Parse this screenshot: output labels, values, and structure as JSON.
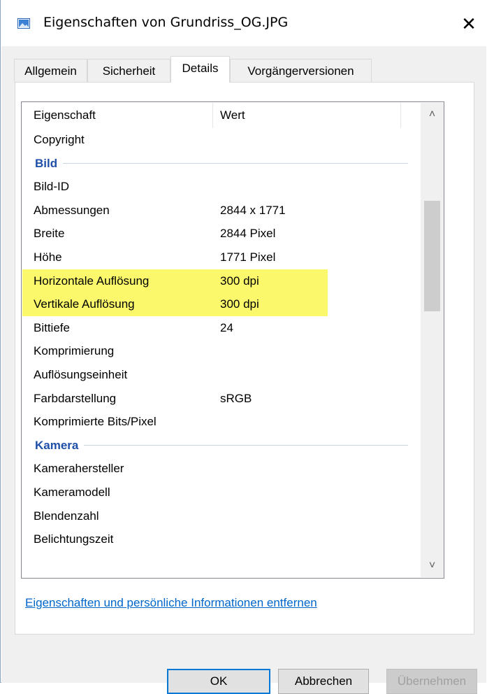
{
  "window": {
    "title": "Eigenschaften von Grundriss_OG.JPG",
    "icon": "image-file-icon",
    "close_label": "✕"
  },
  "tabs": [
    {
      "label": "Allgemein",
      "active": false
    },
    {
      "label": "Sicherheit",
      "active": false
    },
    {
      "label": "Details",
      "active": true
    },
    {
      "label": "Vorgängerversionen",
      "active": false
    }
  ],
  "list": {
    "columns": {
      "name": "Eigenschaft",
      "value": "Wert"
    },
    "rows": [
      {
        "name": "Copyright",
        "value": ""
      },
      {
        "group": "Bild"
      },
      {
        "name": "Bild-ID",
        "value": ""
      },
      {
        "name": "Abmessungen",
        "value": "2844 x 1771"
      },
      {
        "name": "Breite",
        "value": "2844 Pixel"
      },
      {
        "name": "Höhe",
        "value": "1771 Pixel"
      },
      {
        "name": "Horizontale Auflösung",
        "value": "300 dpi",
        "highlighted": true
      },
      {
        "name": "Vertikale Auflösung",
        "value": "300 dpi",
        "highlighted": true
      },
      {
        "name": "Bittiefe",
        "value": "24"
      },
      {
        "name": "Komprimierung",
        "value": ""
      },
      {
        "name": "Auflösungseinheit",
        "value": ""
      },
      {
        "name": "Farbdarstellung",
        "value": "sRGB"
      },
      {
        "name": "Komprimierte Bits/Pixel",
        "value": ""
      },
      {
        "group": "Kamera"
      },
      {
        "name": "Kamerahersteller",
        "value": ""
      },
      {
        "name": "Kameramodell",
        "value": ""
      },
      {
        "name": "Blendenzahl",
        "value": ""
      },
      {
        "name": "Belichtungszeit",
        "value": ""
      }
    ]
  },
  "link": "Eigenschaften und persönliche Informationen entfernen",
  "buttons": {
    "ok": "OK",
    "cancel": "Abbrechen",
    "apply": "Übernehmen"
  },
  "colors": {
    "highlight": "#fbf96b",
    "group_title": "#1e4fa8",
    "link": "#0066cc",
    "default_button_border": "#0078d7"
  }
}
